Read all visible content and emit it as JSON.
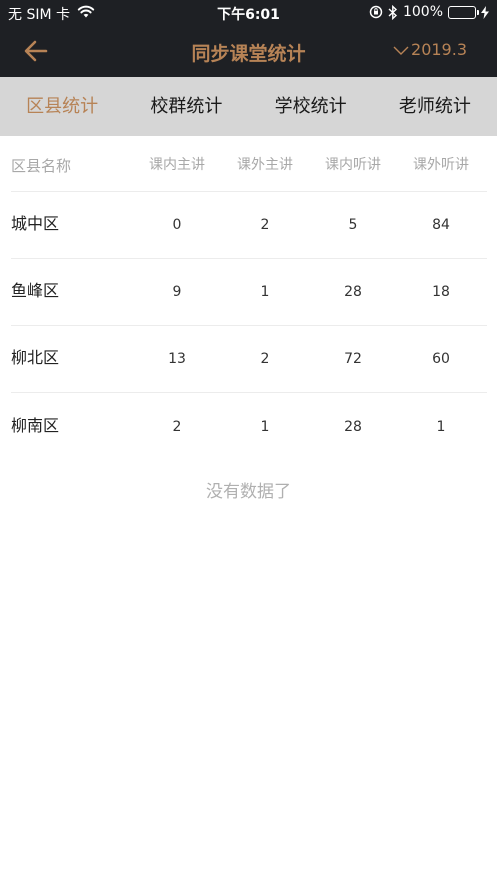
{
  "status_bar": {
    "carrier": "无 SIM 卡",
    "time": "下午6:01",
    "battery": "100%"
  },
  "nav": {
    "title": "同步课堂统计",
    "date": "2019.3"
  },
  "tabs": [
    {
      "label": "区县统计"
    },
    {
      "label": "校群统计"
    },
    {
      "label": "学校统计"
    },
    {
      "label": "老师统计"
    }
  ],
  "table": {
    "headers": [
      "区县名称",
      "课内主讲",
      "课外主讲",
      "课内听讲",
      "课外听讲"
    ],
    "rows": [
      {
        "name": "城中区",
        "values": [
          "0",
          "2",
          "5",
          "84"
        ]
      },
      {
        "name": "鱼峰区",
        "values": [
          "9",
          "1",
          "28",
          "18"
        ]
      },
      {
        "name": "柳北区",
        "values": [
          "13",
          "2",
          "72",
          "60"
        ]
      },
      {
        "name": "柳南区",
        "values": [
          "2",
          "1",
          "28",
          "1"
        ]
      }
    ]
  },
  "empty_text": "没有数据了",
  "colors": {
    "accent": "#b78356",
    "header_bg": "#1e2024",
    "tab_bg": "#d6d6d6",
    "battery": "#4cd964"
  }
}
